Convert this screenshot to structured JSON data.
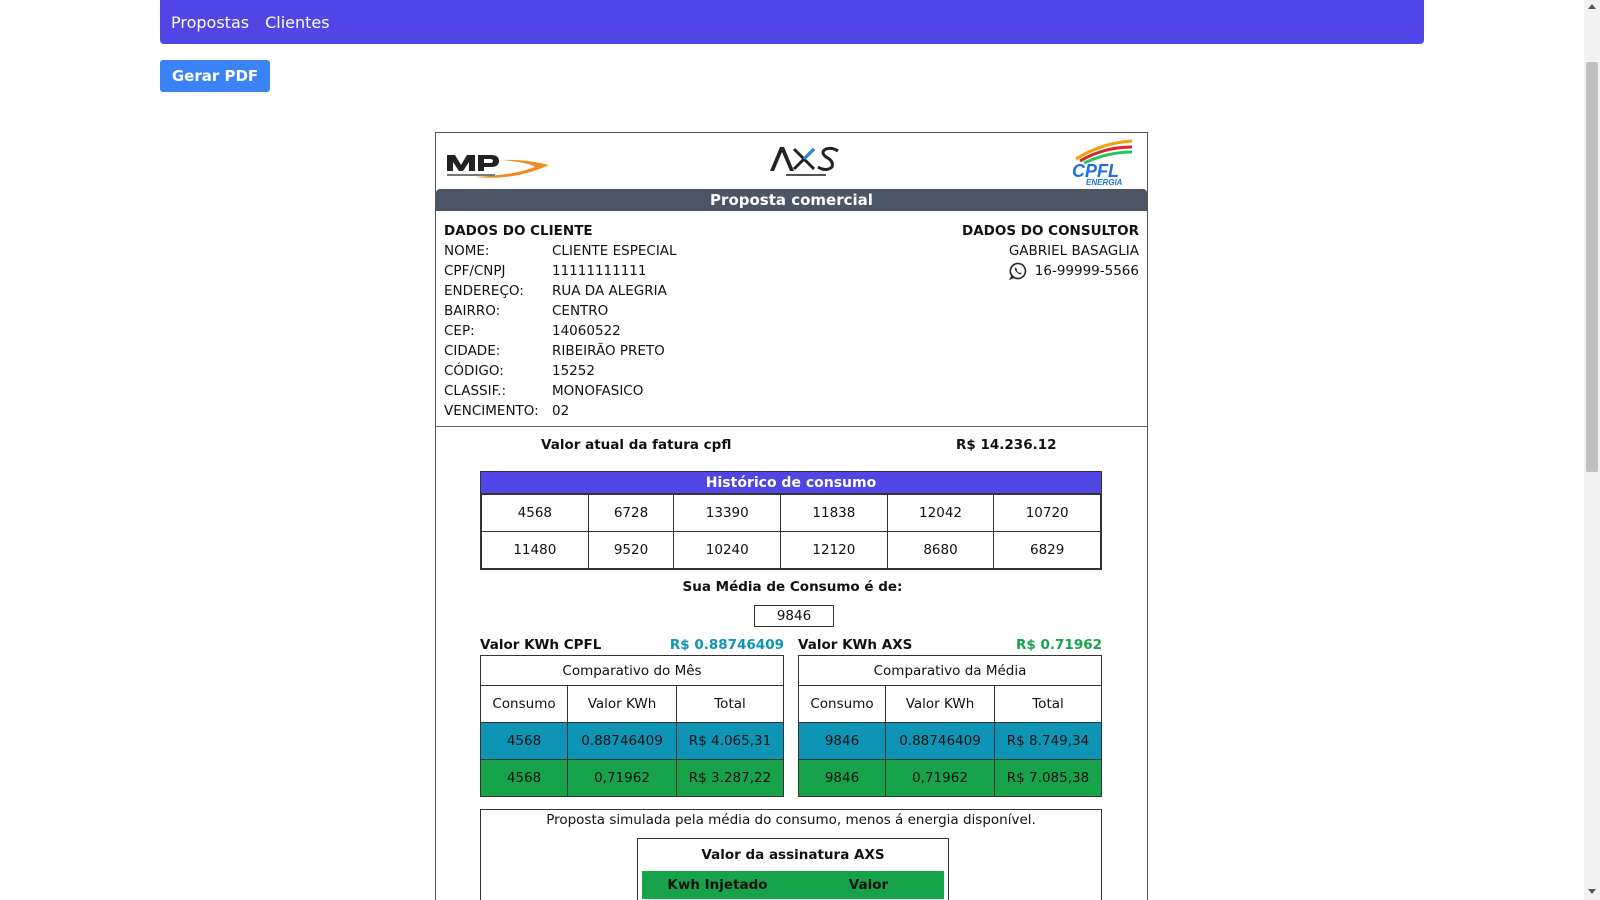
{
  "nav": {
    "items": [
      {
        "label": "Propostas"
      },
      {
        "label": "Clientes"
      }
    ]
  },
  "actions": {
    "pdf_label": "Gerar PDF"
  },
  "logos": {
    "mp": "mp-logo",
    "axs": "axs-energia-logo",
    "cpfl": "cpfl-energia-logo"
  },
  "doc": {
    "title": "Proposta comercial",
    "client": {
      "heading": "DADOS DO CLIENTE",
      "fields": [
        {
          "label": "NOME:",
          "value": "CLIENTE ESPECIAL"
        },
        {
          "label": "CPF/CNPJ",
          "value": "11111111111"
        },
        {
          "label": "ENDEREÇO:",
          "value": "RUA DA ALEGRIA"
        },
        {
          "label": "BAIRRO:",
          "value": "CENTRO"
        },
        {
          "label": "CEP:",
          "value": "14060522"
        },
        {
          "label": "CIDADE:",
          "value": "RIBEIRÃO PRETO"
        },
        {
          "label": "CÓDIGO:",
          "value": "15252"
        },
        {
          "label": "CLASSIF.:",
          "value": "MONOFASICO"
        },
        {
          "label": "VENCIMENTO:",
          "value": "02"
        }
      ]
    },
    "consultant": {
      "heading": "DADOS DO CONSULTOR",
      "name": "GABRIEL BASAGLIA",
      "phone": "16-99999-5566",
      "phone_icon": "whatsapp-icon"
    },
    "fatura": {
      "label": "Valor atual da fatura cpfl",
      "value": "R$ 14.236.12"
    },
    "history": {
      "title": "Histórico de consumo",
      "rows": [
        [
          "4568",
          "6728",
          "13390",
          "11838",
          "12042",
          "10720"
        ],
        [
          "11480",
          "9520",
          "10240",
          "12120",
          "8680",
          "6829"
        ]
      ]
    },
    "media": {
      "label": "Sua Média de Consumo é de:",
      "value": "9846"
    },
    "kwh_cpfl": {
      "label": "Valor KWh CPFL",
      "value": "R$ 0.88746409"
    },
    "kwh_axs": {
      "label": "Valor KWh AXS",
      "value": "R$ 0.71962"
    },
    "comparativo_mes": {
      "caption": "Comparativo do Mês",
      "headers": [
        "Consumo",
        "Valor KWh",
        "Total"
      ],
      "cpfl": [
        "4568",
        "0.88746409",
        "R$ 4.065,31"
      ],
      "axs": [
        "4568",
        "0,71962",
        "R$ 3.287,22"
      ]
    },
    "comparativo_media": {
      "caption": "Comparativo da Média",
      "headers": [
        "Consumo",
        "Valor KWh",
        "Total"
      ],
      "cpfl": [
        "9846",
        "0.88746409",
        "R$ 8.749,34"
      ],
      "axs": [
        "9846",
        "0,71962",
        "R$ 7.085,38"
      ]
    },
    "simulation": {
      "text": "Proposta simulada pela média do consumo, menos á energia disponível.",
      "subscription_title": "Valor da assinatura AXS",
      "headers": [
        "Kwh Injetado",
        "Valor"
      ]
    }
  },
  "colors": {
    "navbar": "#4f46e5",
    "button": "#3b82f6",
    "banner": "#4b5563",
    "cpfl_row": "#0e95b5",
    "axs_row": "#16a34a"
  }
}
